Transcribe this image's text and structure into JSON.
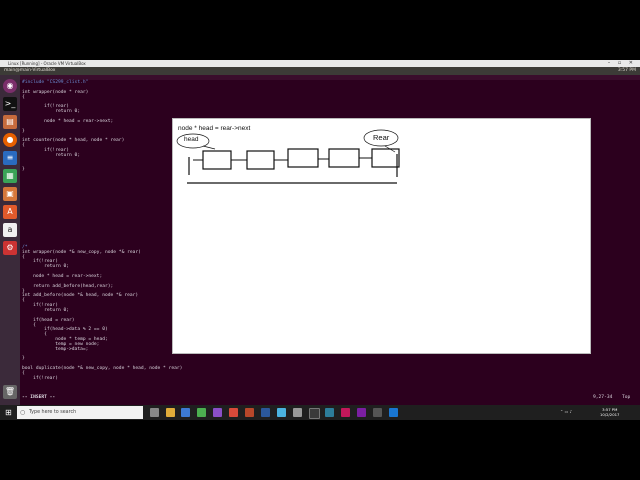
{
  "vbox": {
    "title": "Linux [Running] - Oracle VM VirtualBox"
  },
  "ubuntu": {
    "host": "main@main-VirtualBox",
    "clock": "3:57 PM"
  },
  "editor": {
    "lines": [
      {
        "text": "#include \"CS299_clist.h\"",
        "cls": "cm"
      },
      {
        "text": "",
        "cls": ""
      },
      {
        "text": "int wrapper(node * rear)",
        "cls": ""
      },
      {
        "text": "{",
        "cls": ""
      },
      {
        "text": "",
        "cls": ""
      },
      {
        "text": "        if(!rear)",
        "cls": ""
      },
      {
        "text": "            return 0;",
        "cls": ""
      },
      {
        "text": "",
        "cls": ""
      },
      {
        "text": "        node * head = rear->next;",
        "cls": ""
      },
      {
        "text": "",
        "cls": ""
      },
      {
        "text": "}",
        "cls": ""
      },
      {
        "text": "",
        "cls": ""
      },
      {
        "text": "int counter(node * head, node * rear)",
        "cls": ""
      },
      {
        "text": "{",
        "cls": ""
      },
      {
        "text": "        if(!rear)",
        "cls": ""
      },
      {
        "text": "            return 0;",
        "cls": ""
      },
      {
        "text": "",
        "cls": ""
      },
      {
        "text": "",
        "cls": ""
      },
      {
        "text": "}",
        "cls": ""
      },
      {
        "text": "",
        "cls": ""
      },
      {
        "text": "",
        "cls": ""
      },
      {
        "text": "",
        "cls": ""
      },
      {
        "text": "",
        "cls": ""
      },
      {
        "text": "",
        "cls": ""
      },
      {
        "text": "",
        "cls": ""
      },
      {
        "text": "",
        "cls": ""
      },
      {
        "text": "",
        "cls": ""
      },
      {
        "text": "",
        "cls": ""
      },
      {
        "text": "",
        "cls": ""
      },
      {
        "text": "",
        "cls": ""
      },
      {
        "text": "",
        "cls": ""
      },
      {
        "text": "",
        "cls": ""
      },
      {
        "text": "",
        "cls": ""
      },
      {
        "text": "",
        "cls": ""
      },
      {
        "text": "/*",
        "cls": "cm"
      },
      {
        "text": "int wrapper(node *& new_copy, node *& rear)",
        "cls": ""
      },
      {
        "text": "{",
        "cls": ""
      },
      {
        "text": "    if(!rear)",
        "cls": ""
      },
      {
        "text": "        return 0;",
        "cls": ""
      },
      {
        "text": "",
        "cls": ""
      },
      {
        "text": "    node * head = rear->next;",
        "cls": ""
      },
      {
        "text": "",
        "cls": ""
      },
      {
        "text": "    return add_before(head,rear);",
        "cls": ""
      },
      {
        "text": "}",
        "cls": ""
      },
      {
        "text": "int add_before(node *& head, node *& rear)",
        "cls": ""
      },
      {
        "text": "{",
        "cls": ""
      },
      {
        "text": "    if(!rear)",
        "cls": ""
      },
      {
        "text": "        return 0;",
        "cls": ""
      },
      {
        "text": "",
        "cls": ""
      },
      {
        "text": "    if(head = rear)",
        "cls": ""
      },
      {
        "text": "    {",
        "cls": ""
      },
      {
        "text": "        if(head->data % 2 == 0)",
        "cls": ""
      },
      {
        "text": "        {",
        "cls": ""
      },
      {
        "text": "            node * temp = head;",
        "cls": ""
      },
      {
        "text": "            temp = new node;",
        "cls": ""
      },
      {
        "text": "            temp->data=;",
        "cls": ""
      },
      {
        "text": "",
        "cls": ""
      },
      {
        "text": "}",
        "cls": ""
      },
      {
        "text": "",
        "cls": ""
      },
      {
        "text": "bool duplicate(node *& new_copy, node * head, node * rear)",
        "cls": ""
      },
      {
        "text": "{",
        "cls": ""
      },
      {
        "text": "    if(!rear)",
        "cls": ""
      }
    ],
    "mode": "-- INSERT --",
    "position": "9,27-34",
    "scroll": "Top"
  },
  "whiteboard": {
    "code": "node * head = rear->next",
    "head_label": "head",
    "rear_label": "Rear"
  },
  "taskbar": {
    "search_placeholder": "Type here to search",
    "time": "3:57 PM",
    "date": "10/2/2017"
  },
  "colors": {
    "terminal_bg": "#2c001e",
    "launcher_bg": "#3b2a3a",
    "whiteboard": "#ffffff"
  },
  "icons": [
    "ubuntu-dash-icon",
    "terminal-icon",
    "files-icon",
    "firefox-icon",
    "writer-icon",
    "calc-icon",
    "impress-icon",
    "software-center-icon",
    "amazon-icon",
    "settings-icon",
    "trash-icon"
  ]
}
